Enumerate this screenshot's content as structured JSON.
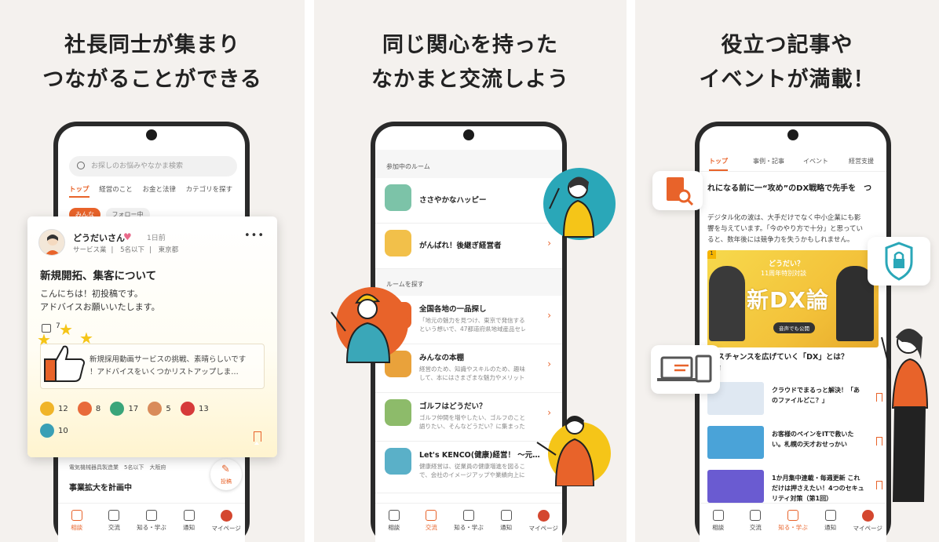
{
  "panels": [
    {
      "headline": [
        "社長同士が集まり",
        "つながることができる"
      ]
    },
    {
      "headline": [
        "同じ関心を持った",
        "なかまと交流しよう"
      ]
    },
    {
      "headline": [
        "役立つ記事や",
        "イベントが満載！"
      ]
    }
  ],
  "screen1": {
    "search_placeholder": "お探しのお悩みやなかま検索",
    "tabs": [
      "トップ",
      "経営のこと",
      "お金と法律",
      "カテゴリを探す"
    ],
    "subtabs": [
      "みんな",
      "フォロー中"
    ],
    "post": {
      "user_name": "どうだいさん",
      "time": "1日前",
      "meta": [
        "サービス業",
        "5名以下",
        "東京都"
      ],
      "title": "新規開拓、集客について",
      "body": [
        "こんにちは！初投稿です。",
        "アドバイスお願いいたします。"
      ],
      "comment_count": "7",
      "reply": [
        "新規採用動画サービスの挑戦、素晴らしいです",
        "！アドバイスをいくつかリストアップしま…"
      ],
      "reactions": [
        {
          "count": "12",
          "color": "#f0b429"
        },
        {
          "count": "8",
          "color": "#e86a3a"
        },
        {
          "count": "17",
          "color": "#3aa57a"
        },
        {
          "count": "5",
          "color": "#d98b5a"
        },
        {
          "count": "13",
          "color": "#d63a3a"
        },
        {
          "count": "10",
          "color": "#3a9fb5"
        }
      ]
    },
    "below": {
      "meta": "電気機械器具製造業　5名以下　大阪府",
      "title": "事業拡大を計画中"
    },
    "fab_label": "投稿",
    "nav": [
      "相談",
      "交流",
      "知る・学ぶ",
      "通知",
      "マイページ"
    ]
  },
  "screen2": {
    "joined_label": "参加中のルーム",
    "joined": [
      {
        "title": "ささやかなハッピー",
        "color": "#7cc3a8"
      },
      {
        "title": "がんばれ！後継ぎ経営者",
        "color": "#f2c04a"
      }
    ],
    "find_label": "ルームを探す",
    "rooms": [
      {
        "title": "全国各地の一品探し",
        "desc": [
          "「地元の魅力を見つけ、東京で発信する」",
          "という想いで、47都道府県地域産品セレ…"
        ],
        "color": "#e8632a"
      },
      {
        "title": "みんなの本棚",
        "desc": [
          "経営のため、知識やスキルのため、趣味と",
          "して、本にはさまざまな魅力やメリット…"
        ],
        "color": "#e9a23b"
      },
      {
        "title": "ゴルフはどうだい？",
        "desc": [
          "ゴルフ仲間を増やしたい、ゴルフのことを",
          "語りたい、そんなどうだい？に集まった…"
        ],
        "color": "#8dbb6a"
      },
      {
        "title": "Let's KENCO(健康)経営！ 〜元…",
        "desc": [
          "健康経営は、従業員の健康増進を図ること",
          "で、会社のイメージアップや業績向上に…"
        ],
        "color": "#5ab0c8"
      }
    ],
    "nav": [
      "相談",
      "交流",
      "知る・学ぶ",
      "通知",
      "マイページ"
    ]
  },
  "screen3": {
    "tabs": [
      "トップ",
      "事例・記事",
      "イベント",
      "経営支援"
    ],
    "article_title": "れになる前に一“攻め”のDX戦略で先手を　つ",
    "article_lead": [
      "デジタル化の波は、大手だけでなく中小企業にも影",
      "響を与えています。「今のやり方で十分」と思ってい",
      "ると、数年後には競争力を失うかもしれません。"
    ],
    "hero": {
      "rank": "1",
      "line1": "どうだい？",
      "line2": "11周年特別対談",
      "big": "新DX論",
      "pill": "音声でも公開"
    },
    "article2": [
      "'ネスチャンスを広げていく「DX」とは？",
      "X論"
    ],
    "list": [
      {
        "title": "クラウドでまるっと解決！「あのファイルどこ？」",
        "color": "#dfe8f2"
      },
      {
        "title": "お客様のペインをITで救いたい。札幌の天才おせっかい",
        "color": "#4aa3d8"
      },
      {
        "title": "1か月集中連載・毎週更新 これだけは押さえたい！4つのセキュリティ対策（第1回）",
        "color": "#6a5bd1"
      }
    ],
    "nav": [
      "相談",
      "交流",
      "知る・学ぶ",
      "通知",
      "マイページ"
    ]
  }
}
